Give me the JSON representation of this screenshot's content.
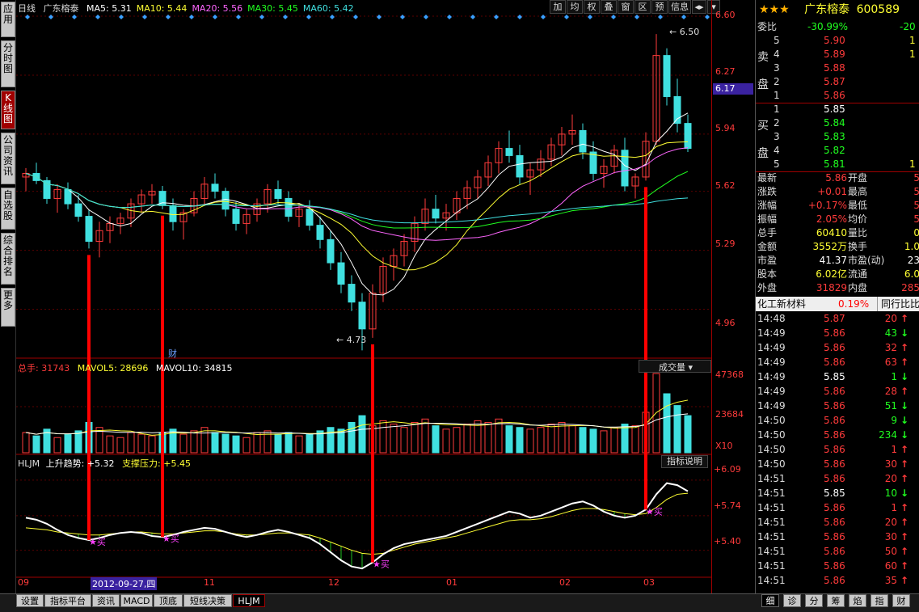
{
  "left_tabs": [
    "应用",
    "分时图",
    "K线图",
    "公司资讯",
    "自选股",
    "综合排名",
    "更多"
  ],
  "main": {
    "period": "日线",
    "stock_name": "广东榕泰",
    "ma": [
      {
        "label": "MA5: 5.31",
        "color": "#ffffff"
      },
      {
        "label": "MA10: 5.44",
        "color": "#ffff33"
      },
      {
        "label": "MA20: 5.56",
        "color": "#ff66ff"
      },
      {
        "label": "MA30: 5.45",
        "color": "#20ff20"
      },
      {
        "label": "MA60: 5.42",
        "color": "#40e0e0"
      }
    ],
    "toolbar": [
      "加",
      "均",
      "权",
      "叠",
      "窗",
      "区",
      "预",
      "信息",
      "◂▸",
      "▾"
    ],
    "price_axis": [
      "6.60",
      "6.27",
      "6.17",
      "5.94",
      "5.62",
      "5.29",
      "4.96"
    ],
    "high_annotation": "6.50",
    "low_annotation": "4.73",
    "finance_marker": "财",
    "volume_legend": {
      "total": "总手: 31743",
      "ma5": "MAVOL5: 28696",
      "ma10": "MAVOL10: 34815"
    },
    "volume_dropdown": "成交量",
    "volume_axis": [
      "47368",
      "23684",
      "X10"
    ],
    "indicator_legend": {
      "name": "HLJM",
      "trend": "上升趋势: +5.32",
      "support": "支撑压力: +5.45"
    },
    "indicator_button": "指标说明",
    "indicator_axis": [
      "+6.09",
      "+5.74",
      "+5.40"
    ],
    "buy_label": "买",
    "date_axis": [
      "09",
      "2012-09-27,四",
      "11",
      "12",
      "01",
      "02",
      "03"
    ]
  },
  "chart_data": {
    "type": "candlestick",
    "title": "广东榕泰 日线",
    "ylim": [
      4.7,
      6.6
    ],
    "ohlc": [
      [
        5.7,
        5.75,
        5.62,
        5.72
      ],
      [
        5.72,
        5.78,
        5.66,
        5.68
      ],
      [
        5.68,
        5.7,
        5.55,
        5.58
      ],
      [
        5.58,
        5.66,
        5.5,
        5.63
      ],
      [
        5.63,
        5.67,
        5.52,
        5.55
      ],
      [
        5.55,
        5.6,
        5.45,
        5.48
      ],
      [
        5.48,
        5.52,
        5.3,
        5.34
      ],
      [
        5.34,
        5.45,
        5.25,
        5.4
      ],
      [
        5.4,
        5.48,
        5.33,
        5.44
      ],
      [
        5.44,
        5.5,
        5.38,
        5.47
      ],
      [
        5.47,
        5.58,
        5.42,
        5.55
      ],
      [
        5.55,
        5.63,
        5.5,
        5.6
      ],
      [
        5.6,
        5.66,
        5.55,
        5.62
      ],
      [
        5.62,
        5.65,
        5.52,
        5.54
      ],
      [
        5.54,
        5.58,
        5.4,
        5.45
      ],
      [
        5.45,
        5.52,
        5.35,
        5.5
      ],
      [
        5.5,
        5.62,
        5.48,
        5.58
      ],
      [
        5.58,
        5.7,
        5.54,
        5.66
      ],
      [
        5.66,
        5.72,
        5.58,
        5.62
      ],
      [
        5.62,
        5.64,
        5.48,
        5.52
      ],
      [
        5.52,
        5.56,
        5.4,
        5.44
      ],
      [
        5.44,
        5.52,
        5.38,
        5.49
      ],
      [
        5.49,
        5.58,
        5.45,
        5.55
      ],
      [
        5.55,
        5.66,
        5.5,
        5.63
      ],
      [
        5.63,
        5.68,
        5.55,
        5.58
      ],
      [
        5.58,
        5.62,
        5.45,
        5.48
      ],
      [
        5.48,
        5.55,
        5.42,
        5.52
      ],
      [
        5.52,
        5.57,
        5.4,
        5.43
      ],
      [
        5.43,
        5.48,
        5.3,
        5.35
      ],
      [
        5.35,
        5.4,
        5.18,
        5.22
      ],
      [
        5.22,
        5.28,
        5.05,
        5.1
      ],
      [
        5.1,
        5.15,
        4.95,
        5.0
      ],
      [
        5.0,
        5.05,
        4.73,
        4.85
      ],
      [
        4.85,
        5.1,
        4.8,
        5.05
      ],
      [
        5.05,
        5.25,
        5.0,
        5.2
      ],
      [
        5.2,
        5.3,
        5.12,
        5.26
      ],
      [
        5.26,
        5.38,
        5.2,
        5.34
      ],
      [
        5.34,
        5.48,
        5.28,
        5.44
      ],
      [
        5.44,
        5.58,
        5.4,
        5.52
      ],
      [
        5.52,
        5.6,
        5.44,
        5.47
      ],
      [
        5.47,
        5.55,
        5.4,
        5.5
      ],
      [
        5.5,
        5.62,
        5.46,
        5.58
      ],
      [
        5.58,
        5.68,
        5.52,
        5.64
      ],
      [
        5.64,
        5.74,
        5.58,
        5.7
      ],
      [
        5.7,
        5.82,
        5.65,
        5.78
      ],
      [
        5.78,
        5.9,
        5.72,
        5.86
      ],
      [
        5.86,
        5.96,
        5.78,
        5.82
      ],
      [
        5.82,
        5.88,
        5.66,
        5.7
      ],
      [
        5.7,
        5.78,
        5.6,
        5.74
      ],
      [
        5.74,
        5.85,
        5.7,
        5.8
      ],
      [
        5.8,
        5.92,
        5.76,
        5.88
      ],
      [
        5.88,
        5.98,
        5.82,
        5.94
      ],
      [
        5.94,
        6.05,
        5.88,
        5.96
      ],
      [
        5.96,
        6.0,
        5.8,
        5.84
      ],
      [
        5.84,
        5.9,
        5.68,
        5.72
      ],
      [
        5.72,
        5.8,
        5.64,
        5.76
      ],
      [
        5.76,
        5.88,
        5.72,
        5.85
      ],
      [
        5.85,
        5.92,
        5.62,
        5.65
      ],
      [
        5.65,
        5.72,
        5.58,
        5.7
      ],
      [
        5.7,
        5.95,
        5.68,
        5.9
      ],
      [
        5.9,
        6.5,
        5.88,
        6.38
      ],
      [
        6.38,
        6.42,
        6.1,
        6.15
      ],
      [
        6.15,
        6.25,
        5.95,
        6.0
      ],
      [
        6.0,
        6.05,
        5.84,
        5.86
      ]
    ],
    "volume": [
      12,
      10,
      14,
      9,
      11,
      13,
      18,
      15,
      10,
      9,
      12,
      11,
      10,
      12,
      14,
      11,
      13,
      15,
      12,
      11,
      10,
      9,
      12,
      13,
      11,
      12,
      10,
      11,
      13,
      15,
      14,
      18,
      22,
      16,
      19,
      17,
      15,
      18,
      20,
      16,
      14,
      15,
      17,
      19,
      18,
      20,
      16,
      15,
      14,
      15,
      17,
      18,
      16,
      15,
      14,
      13,
      15,
      17,
      16,
      24,
      47,
      35,
      28,
      22
    ],
    "indicator": {
      "trend_line": [
        5.72,
        5.7,
        5.66,
        5.6,
        5.55,
        5.52,
        5.5,
        5.52,
        5.55,
        5.57,
        5.58,
        5.57,
        5.54,
        5.53,
        5.55,
        5.58,
        5.6,
        5.62,
        5.61,
        5.58,
        5.55,
        5.53,
        5.55,
        5.58,
        5.6,
        5.58,
        5.55,
        5.52,
        5.46,
        5.38,
        5.3,
        5.24,
        5.22,
        5.28,
        5.36,
        5.42,
        5.46,
        5.48,
        5.5,
        5.52,
        5.54,
        5.58,
        5.62,
        5.66,
        5.7,
        5.74,
        5.78,
        5.76,
        5.72,
        5.74,
        5.78,
        5.82,
        5.86,
        5.88,
        5.84,
        5.78,
        5.74,
        5.72,
        5.74,
        5.8,
        5.95,
        6.06,
        6.04,
        5.98
      ],
      "support_line": [
        5.62,
        5.61,
        5.6,
        5.58,
        5.57,
        5.56,
        5.55,
        5.55,
        5.56,
        5.57,
        5.58,
        5.58,
        5.57,
        5.56,
        5.56,
        5.57,
        5.58,
        5.59,
        5.59,
        5.58,
        5.56,
        5.55,
        5.55,
        5.56,
        5.57,
        5.57,
        5.56,
        5.55,
        5.52,
        5.48,
        5.44,
        5.4,
        5.37,
        5.36,
        5.37,
        5.4,
        5.43,
        5.46,
        5.48,
        5.5,
        5.52,
        5.54,
        5.57,
        5.6,
        5.63,
        5.66,
        5.69,
        5.7,
        5.7,
        5.71,
        5.73,
        5.76,
        5.79,
        5.81,
        5.81,
        5.8,
        5.78,
        5.76,
        5.75,
        5.76,
        5.82,
        5.9,
        5.95,
        5.96
      ],
      "ylim": [
        5.15,
        6.2
      ]
    },
    "buy_signals": [
      6,
      13,
      33,
      59
    ],
    "ylabel": "",
    "xlabel": ""
  },
  "quote": {
    "stars": "★★★",
    "name": "广东榕泰",
    "code": "600589",
    "weibi_label": "委比",
    "weibi_value": "-30.99%",
    "weibi_diff": "-20",
    "sell_label_1": "卖",
    "sell_label_2": "盘",
    "buy_label_1": "买",
    "buy_label_2": "盘",
    "sell": [
      {
        "lvl": "5",
        "price": "5.90",
        "vol": "1"
      },
      {
        "lvl": "4",
        "price": "5.89",
        "vol": "1"
      },
      {
        "lvl": "3",
        "price": "5.88",
        "vol": ""
      },
      {
        "lvl": "2",
        "price": "5.87",
        "vol": ""
      },
      {
        "lvl": "1",
        "price": "5.86",
        "vol": ""
      }
    ],
    "buy": [
      {
        "lvl": "1",
        "price": "5.85",
        "vol": ""
      },
      {
        "lvl": "2",
        "price": "5.84",
        "vol": ""
      },
      {
        "lvl": "3",
        "price": "5.83",
        "vol": ""
      },
      {
        "lvl": "4",
        "price": "5.82",
        "vol": ""
      },
      {
        "lvl": "5",
        "price": "5.81",
        "vol": "1"
      }
    ],
    "stats": [
      {
        "k1": "最新",
        "v1": "5.86",
        "k2": "开盘",
        "v2": "5"
      },
      {
        "k1": "涨跌",
        "v1": "+0.01",
        "k2": "最高",
        "v2": "5"
      },
      {
        "k1": "涨幅",
        "v1": "+0.17%",
        "k2": "最低",
        "v2": "5"
      },
      {
        "k1": "振幅",
        "v1": "2.05%",
        "k2": "均价",
        "v2": "5"
      },
      {
        "k1": "总手",
        "v1": "60410",
        "k2": "量比",
        "v2": "0"
      },
      {
        "k1": "金额",
        "v1": "3552万",
        "k2": "换手",
        "v2": "1.0"
      },
      {
        "k1": "市盈",
        "v1": "41.37",
        "k2": "市盈(动)",
        "v2": "23"
      },
      {
        "k1": "股本",
        "v1": "6.02亿",
        "k2": "流通",
        "v2": "6.0"
      },
      {
        "k1": "外盘",
        "v1": "31829",
        "k2": "内盘",
        "v2": "285"
      }
    ],
    "sector_name": "化工新材料",
    "sector_change": "0.19%",
    "sector_button": "同行比比",
    "ticks": [
      {
        "t": "14:48",
        "p": "5.87",
        "v": "20",
        "d": "up"
      },
      {
        "t": "14:49",
        "p": "5.86",
        "v": "43",
        "d": "down"
      },
      {
        "t": "14:49",
        "p": "5.86",
        "v": "32",
        "d": "up"
      },
      {
        "t": "14:49",
        "p": "5.86",
        "v": "63",
        "d": "up"
      },
      {
        "t": "14:49",
        "p": "5.85",
        "v": "1",
        "d": "down"
      },
      {
        "t": "14:49",
        "p": "5.86",
        "v": "28",
        "d": "up"
      },
      {
        "t": "14:49",
        "p": "5.86",
        "v": "51",
        "d": "down"
      },
      {
        "t": "14:50",
        "p": "5.86",
        "v": "9",
        "d": "down"
      },
      {
        "t": "14:50",
        "p": "5.86",
        "v": "234",
        "d": "down"
      },
      {
        "t": "14:50",
        "p": "5.86",
        "v": "1",
        "d": "up"
      },
      {
        "t": "14:50",
        "p": "5.86",
        "v": "30",
        "d": "up"
      },
      {
        "t": "14:51",
        "p": "5.86",
        "v": "20",
        "d": "up"
      },
      {
        "t": "14:51",
        "p": "5.85",
        "v": "10",
        "d": "down"
      },
      {
        "t": "14:51",
        "p": "5.86",
        "v": "1",
        "d": "up"
      },
      {
        "t": "14:51",
        "p": "5.86",
        "v": "20",
        "d": "up"
      },
      {
        "t": "14:51",
        "p": "5.86",
        "v": "30",
        "d": "up"
      },
      {
        "t": "14:51",
        "p": "5.86",
        "v": "50",
        "d": "up"
      },
      {
        "t": "14:51",
        "p": "5.86",
        "v": "60",
        "d": "up"
      },
      {
        "t": "14:51",
        "p": "5.86",
        "v": "35",
        "d": "up"
      }
    ]
  },
  "bottom_tabs": [
    "设置",
    "指标平台",
    "资讯",
    "MACD",
    "顶底",
    "短线决策",
    "HLJM"
  ],
  "active_bottom_tab": "HLJM",
  "right_bottom_tabs": [
    "细",
    "诊",
    "分",
    "筹",
    "焰",
    "指",
    "财"
  ],
  "colors": {
    "up": "#ff3b3b",
    "down": "#40e0e0",
    "signal": "#ff0000",
    "buy_star": "#ff40ff"
  }
}
